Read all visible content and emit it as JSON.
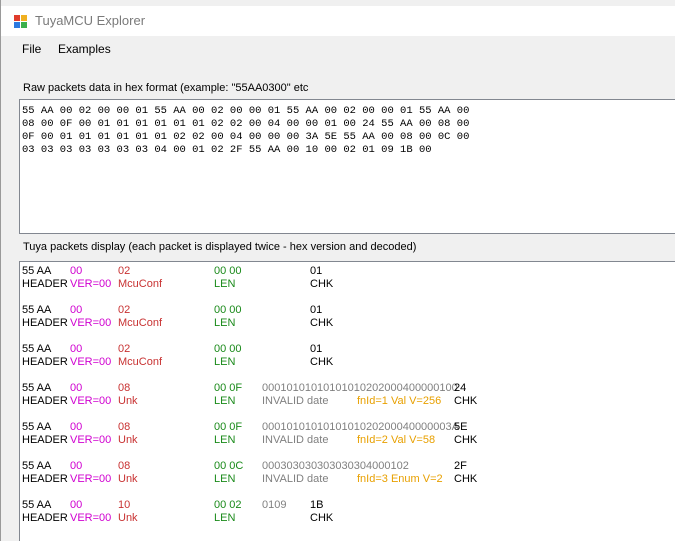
{
  "window": {
    "title": "TuyaMCU Explorer"
  },
  "menu": {
    "file": "File",
    "examples": "Examples"
  },
  "raw_label": "Raw packets data in hex format (example: \"55AA0300\" etc",
  "raw_lines": [
    "55 AA 00 02 00 00 01 55 AA 00 02 00 00 01 55 AA 00 02 00 00 01 55 AA 00",
    "08 00 0F 00 01 01 01 01 01 01 02 02 00 04 00 00 01 00 24 55 AA 00 08 00",
    "0F 00 01 01 01 01 01 01 02 02 00 04 00 00 00 3A 5E 55 AA 00 08 00 0C 00",
    "03 03 03 03 03 03 03 04 00 01 02 2F 55 AA 00 10 00 02 01 09 1B 00"
  ],
  "display_label": "Tuya packets display (each packet is displayed twice - hex version and decoded)",
  "packets": [
    {
      "hex": {
        "header": "55 AA",
        "ver": "00",
        "cmd": "02",
        "len": "00 00",
        "data": "",
        "chk": "01"
      },
      "dec": {
        "header": "HEADER",
        "ver": "VER=00",
        "cmd": "McuConf",
        "len": "LEN",
        "data": "",
        "extra": "",
        "chk": "CHK"
      }
    },
    {
      "hex": {
        "header": "55 AA",
        "ver": "00",
        "cmd": "02",
        "len": "00 00",
        "data": "",
        "chk": "01"
      },
      "dec": {
        "header": "HEADER",
        "ver": "VER=00",
        "cmd": "McuConf",
        "len": "LEN",
        "data": "",
        "extra": "",
        "chk": "CHK"
      }
    },
    {
      "hex": {
        "header": "55 AA",
        "ver": "00",
        "cmd": "02",
        "len": "00 00",
        "data": "",
        "chk": "01"
      },
      "dec": {
        "header": "HEADER",
        "ver": "VER=00",
        "cmd": "McuConf",
        "len": "LEN",
        "data": "",
        "extra": "",
        "chk": "CHK"
      }
    },
    {
      "hex": {
        "header": "55 AA",
        "ver": "00",
        "cmd": "08",
        "len": "00 0F",
        "data": "00010101010101010202000400000100",
        "chk": "24"
      },
      "dec": {
        "header": "HEADER",
        "ver": "VER=00",
        "cmd": "Unk",
        "len": "LEN",
        "data": "INVALID date",
        "extra": "fnId=1 Val V=256",
        "chk": "CHK"
      }
    },
    {
      "hex": {
        "header": "55 AA",
        "ver": "00",
        "cmd": "08",
        "len": "00 0F",
        "data": "0001010101010101020200040000003A",
        "chk": "5E"
      },
      "dec": {
        "header": "HEADER",
        "ver": "VER=00",
        "cmd": "Unk",
        "len": "LEN",
        "data": "INVALID date",
        "extra": "fnId=2 Val V=58",
        "chk": "CHK"
      }
    },
    {
      "hex": {
        "header": "55 AA",
        "ver": "00",
        "cmd": "08",
        "len": "00 0C",
        "data": "000303030303030304000102",
        "chk": "2F"
      },
      "dec": {
        "header": "HEADER",
        "ver": "VER=00",
        "cmd": "Unk",
        "len": "LEN",
        "data": "INVALID date",
        "extra": "fnId=3 Enum V=2",
        "chk": "CHK"
      }
    },
    {
      "hex": {
        "header": "55 AA",
        "ver": "00",
        "cmd": "10",
        "len": "00 02",
        "data": "0109",
        "chk": "1B"
      },
      "dec": {
        "header": "HEADER",
        "ver": "VER=00",
        "cmd": "Unk",
        "len": "LEN",
        "data": "",
        "extra": "",
        "chk": "CHK"
      }
    }
  ],
  "colors": {
    "ver": "#d000d0",
    "cmd": "#c83232",
    "len": "#1a8a1a",
    "data": "#808080",
    "extra": "#e8a000"
  }
}
